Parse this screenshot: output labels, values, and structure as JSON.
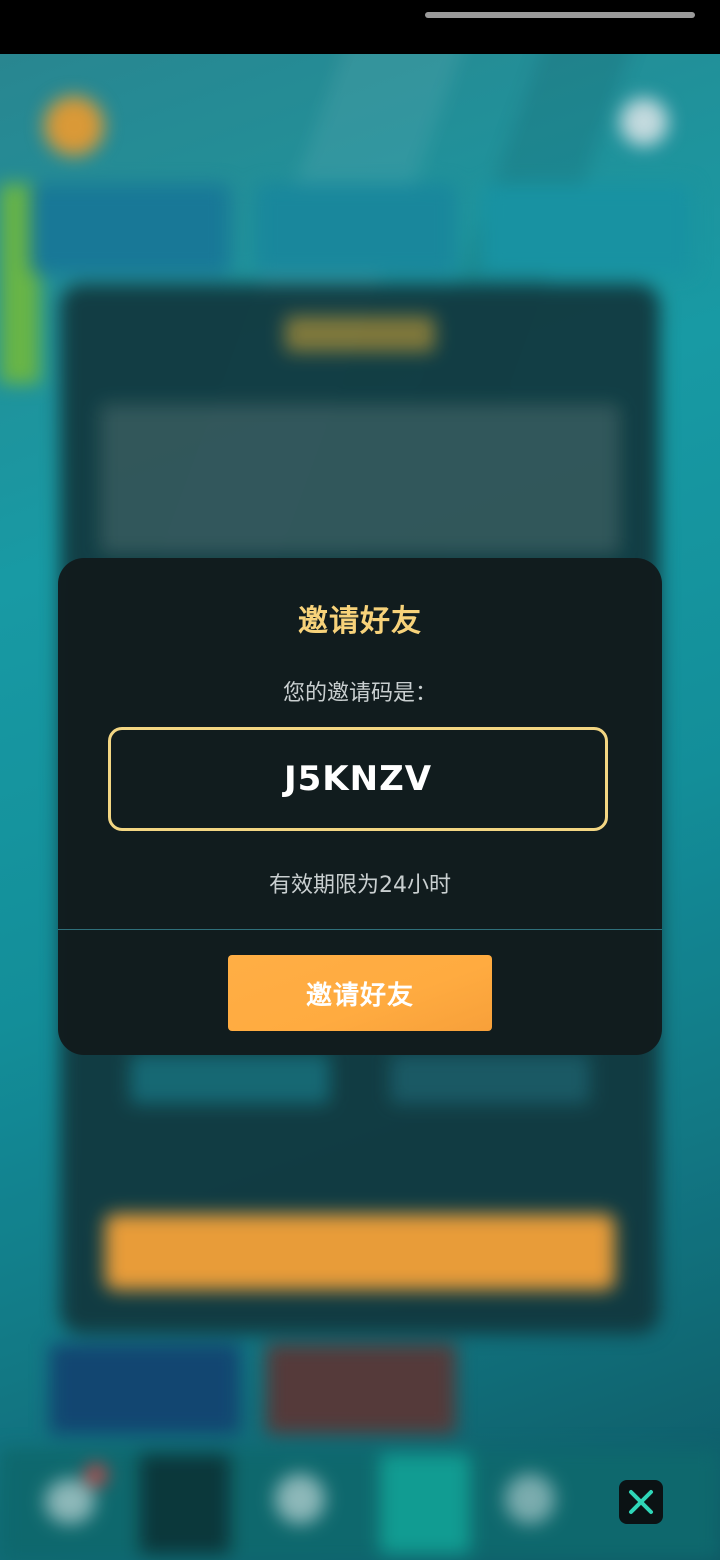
{
  "dialog": {
    "title": "邀请好友",
    "subtitle": "您的邀请码是：",
    "invite_code": "J5KNZV",
    "validity": "有效期限为24小时",
    "button_label": "邀请好友"
  },
  "colors": {
    "title": "#f7d27a",
    "code_border": "#f3d683",
    "button": "#ffab40",
    "dialog_bg": "#121b1d",
    "close_icon": "#2fd6b8"
  },
  "icons": {
    "close": "close-icon"
  }
}
